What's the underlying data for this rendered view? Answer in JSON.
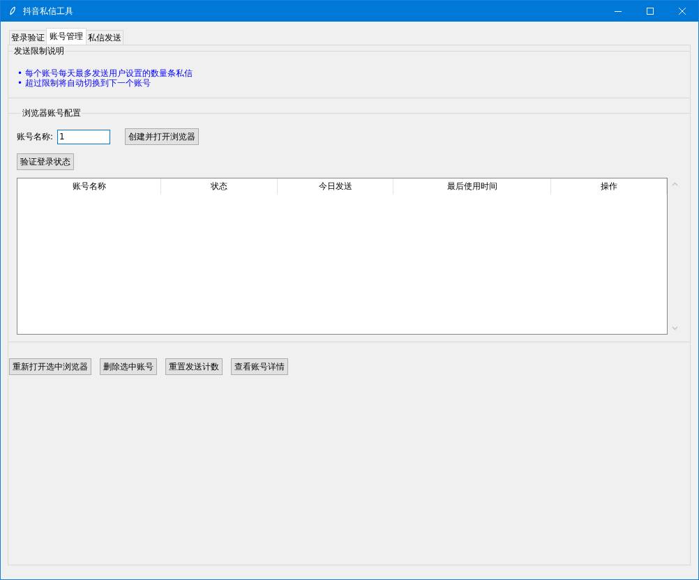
{
  "window": {
    "title": "抖音私信工具"
  },
  "tabs": [
    {
      "label": "登录验证",
      "selected": false
    },
    {
      "label": "账号管理",
      "selected": true
    },
    {
      "label": "私信发送",
      "selected": false
    }
  ],
  "limit_info": {
    "title": "发送限制说明",
    "lines": [
      "• 每个账号每天最多发送用户设置的数量条私信",
      "• 超过限制将自动切换到下一个账号"
    ]
  },
  "account_config": {
    "title": "浏览器账号配置",
    "name_label": "账号名称:",
    "name_field": {
      "value": "1"
    },
    "create_button": "创建并打开浏览器",
    "verify_button": "验证登录状态",
    "table": {
      "columns": [
        "账号名称",
        "状态",
        "今日发送",
        "最后使用时间",
        "操作"
      ]
    }
  },
  "buttons": [
    "重新打开选中浏览器",
    "删除选中账号",
    "重置发送计数",
    "查看账号详情"
  ]
}
